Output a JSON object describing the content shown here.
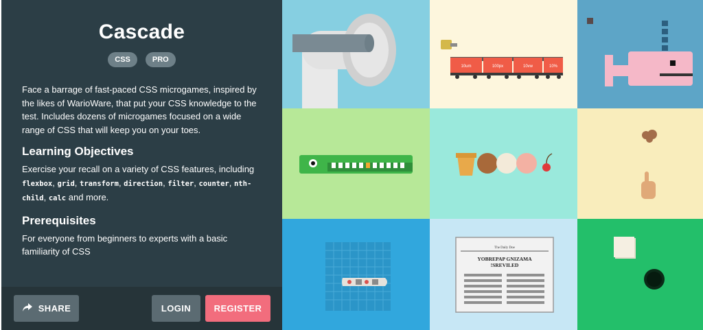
{
  "course": {
    "title": "Cascade",
    "tags": [
      "CSS",
      "PRO"
    ],
    "description": "Face a barrage of fast-paced CSS microgames, inspired by the likes of WarioWare, that put your CSS knowledge to the test. Includes dozens of microgames focused on a wide range of CSS that will keep you on your toes.",
    "objectives_heading": "Learning Objectives",
    "objectives_intro": "Exercise your recall on a variety of CSS features, including",
    "objectives_features": [
      "flexbox",
      "grid",
      "transform",
      "direction",
      "filter",
      "counter",
      "nth-child",
      "calc"
    ],
    "objectives_tail": "and more.",
    "prereq_heading": "Prerequisites",
    "prereq_text": "For everyone from beginners to experts with a basic familiarity of CSS"
  },
  "actions": {
    "share_label": "SHARE",
    "login_label": "LOGIN",
    "register_label": "REGISTER",
    "register_color": "#f26d7d"
  },
  "tiles": {
    "train_labels": [
      "10um",
      "100px",
      "10vw",
      "10%"
    ],
    "newspaper_masthead": "The Daily Doe",
    "newspaper_headline_1": "YOBREPAP GNIZAMA",
    "newspaper_headline_2": "!SREVILED"
  },
  "icons": {
    "share": "share-arrow-icon"
  }
}
